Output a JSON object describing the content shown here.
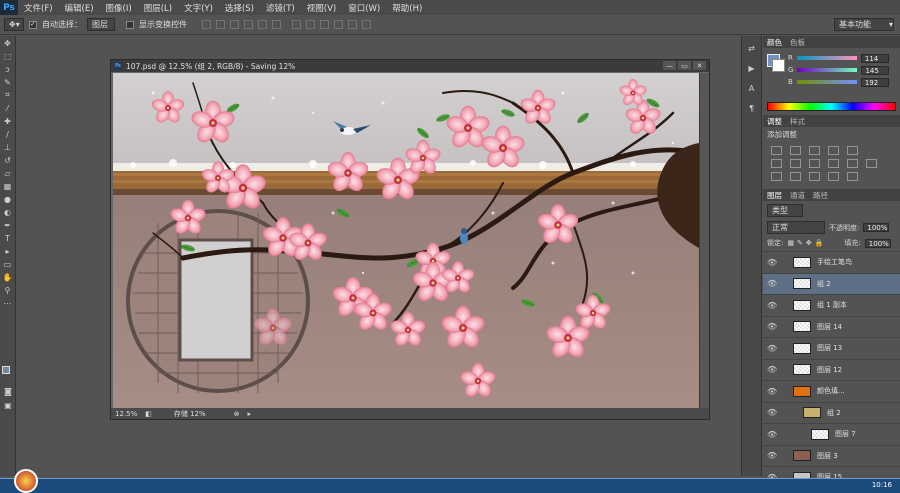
{
  "app": {
    "logo": "Ps"
  },
  "menu": [
    "文件(F)",
    "编辑(E)",
    "图像(I)",
    "图层(L)",
    "文字(Y)",
    "选择(S)",
    "滤镜(T)",
    "视图(V)",
    "窗口(W)",
    "帮助(H)"
  ],
  "options_bar": {
    "auto_select_label": "自动选择：",
    "auto_select_value": "图层",
    "transform_label": "显示变换控件",
    "workspace": "基本功能"
  },
  "document": {
    "title": "107.psd @ 12.5% (组 2, RGB/8) - Saving 12%",
    "zoom": "12.5%",
    "status": "存储 12%"
  },
  "color_panel": {
    "tabs": [
      "颜色",
      "色板"
    ],
    "channels": [
      {
        "name": "R",
        "value": "114"
      },
      {
        "name": "G",
        "value": "145"
      },
      {
        "name": "B",
        "value": "192"
      }
    ],
    "fg_color": "#7291c0"
  },
  "adjust_panel": {
    "tabs": [
      "调整",
      "样式"
    ],
    "title": "添加调整"
  },
  "layers_panel": {
    "tabs": [
      "图层",
      "通道",
      "路径"
    ],
    "filter": "类型",
    "blend_mode": "正常",
    "opacity_label": "不透明度:",
    "opacity_value": "100%",
    "lock_label": "锁定:",
    "fill_label": "填充:",
    "fill_value": "100%",
    "layers": [
      {
        "name": "手绘工笔鸟",
        "selected": false
      },
      {
        "name": "组 2",
        "selected": true
      },
      {
        "name": "组 1 副本",
        "selected": false
      },
      {
        "name": "图层 14",
        "selected": false
      },
      {
        "name": "图层 13",
        "selected": false
      },
      {
        "name": "图层 12",
        "selected": false
      },
      {
        "name": "颜色填...",
        "selected": false
      },
      {
        "name": "组 2",
        "selected": false
      },
      {
        "name": "图层 7",
        "selected": false
      },
      {
        "name": "图层 3",
        "selected": false
      },
      {
        "name": "图层 15",
        "selected": false
      }
    ]
  },
  "taskbar": {
    "clock": "10:16"
  }
}
